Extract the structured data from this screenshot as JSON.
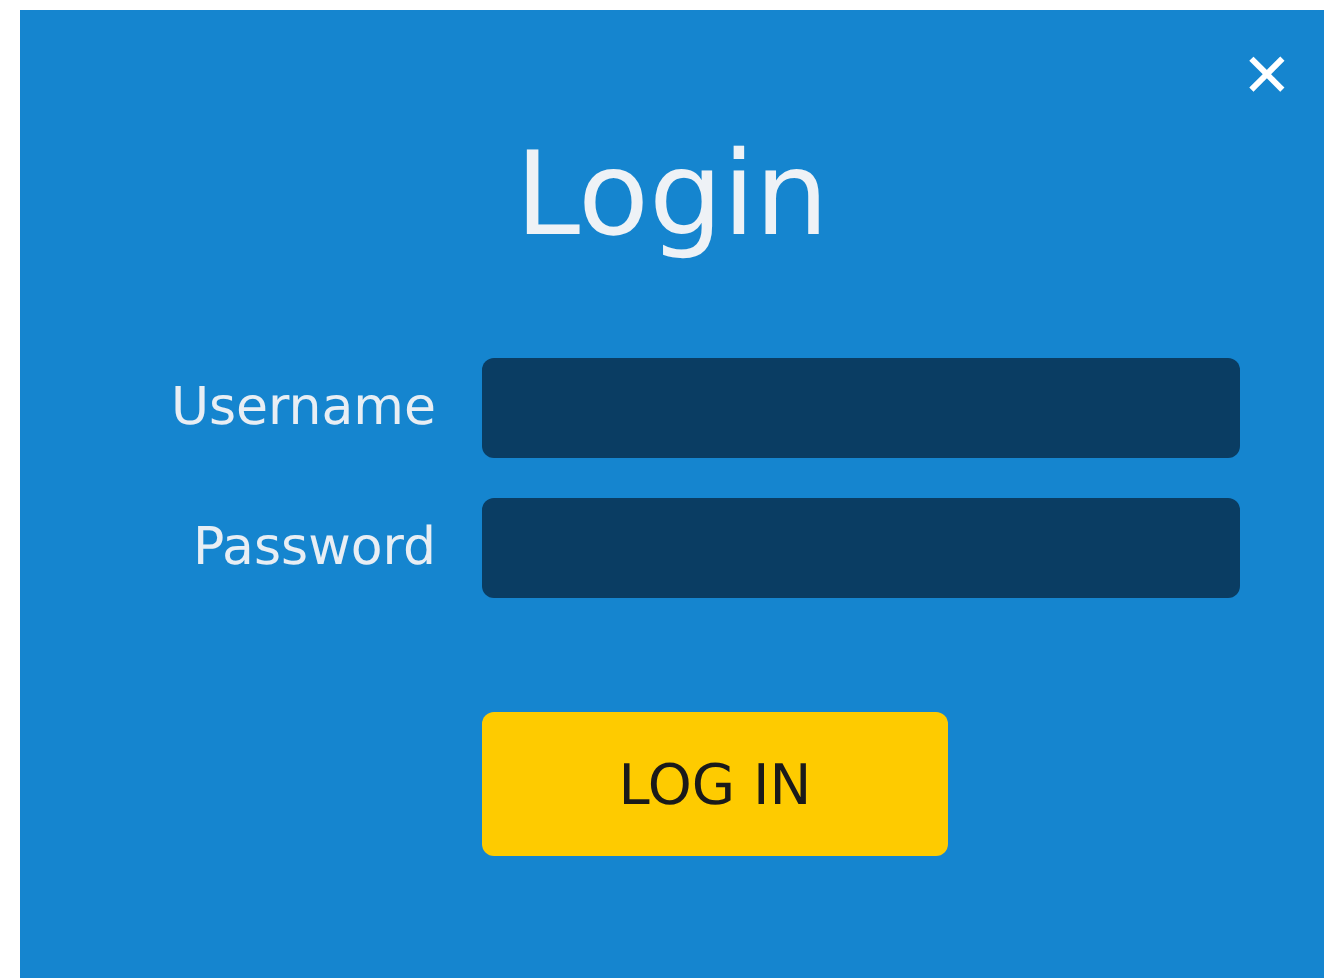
{
  "dialog": {
    "title": "Login",
    "close": "✕"
  },
  "fields": [
    {
      "label": "Username"
    },
    {
      "label": "Password"
    }
  ],
  "button": "LOG IN"
}
